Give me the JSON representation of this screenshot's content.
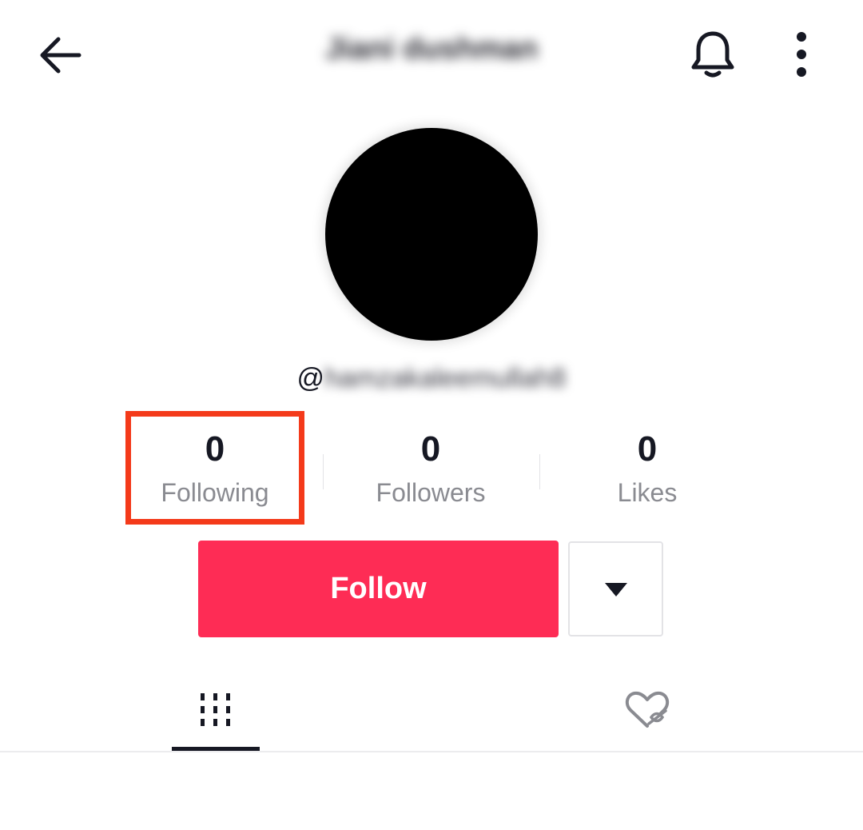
{
  "header": {
    "title": "Jiani dushman",
    "icons": {
      "back": "arrow-left-icon",
      "notifications": "bell-icon",
      "more": "more-vertical-icon"
    }
  },
  "profile": {
    "at_symbol": "@",
    "handle": "hamzakaleemullah8"
  },
  "stats": {
    "following": {
      "value": "0",
      "label": "Following"
    },
    "followers": {
      "value": "0",
      "label": "Followers"
    },
    "likes": {
      "value": "0",
      "label": "Likes"
    }
  },
  "actions": {
    "follow_label": "Follow",
    "dropdown_icon": "caret-down-icon"
  },
  "tabs": {
    "videos_icon": "grid-bars-icon",
    "liked_icon": "heart-hidden-icon",
    "active": "videos"
  },
  "colors": {
    "accent": "#fe2c55",
    "highlight": "#f43a1a",
    "text_primary": "#161823",
    "text_secondary": "#8a8b91"
  }
}
